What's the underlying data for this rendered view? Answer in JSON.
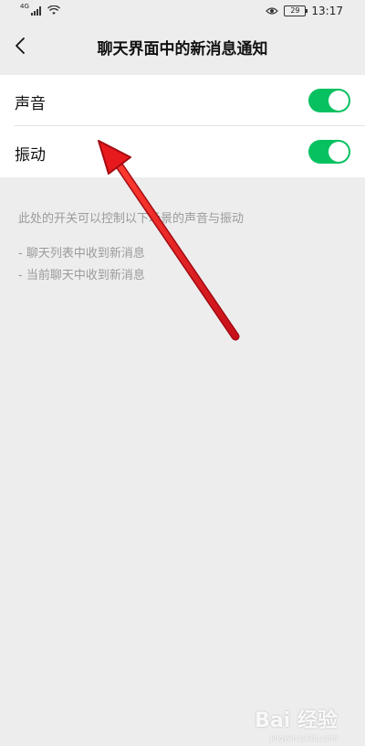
{
  "status_bar": {
    "signal_label": "4G",
    "battery": "29",
    "time": "13:17",
    "icons": [
      "signal-icon",
      "wifi-icon",
      "eye-icon",
      "battery-icon"
    ]
  },
  "nav": {
    "back_icon": "chevron-left-icon",
    "title": "聊天界面中的新消息通知"
  },
  "settings": [
    {
      "label": "声音",
      "enabled": true
    },
    {
      "label": "振动",
      "enabled": true
    }
  ],
  "hint": {
    "description": "此处的开关可以控制以下场景的声音与振动",
    "items": [
      "- 聊天列表中收到新消息",
      "- 当前聊天中收到新消息"
    ]
  },
  "watermark": {
    "text": "Bai 经验",
    "sub": "jingyan.baidu.com"
  },
  "colors": {
    "toggle_on": "#07c160",
    "background": "#ededed",
    "annotation_arrow": "#e8191d"
  }
}
